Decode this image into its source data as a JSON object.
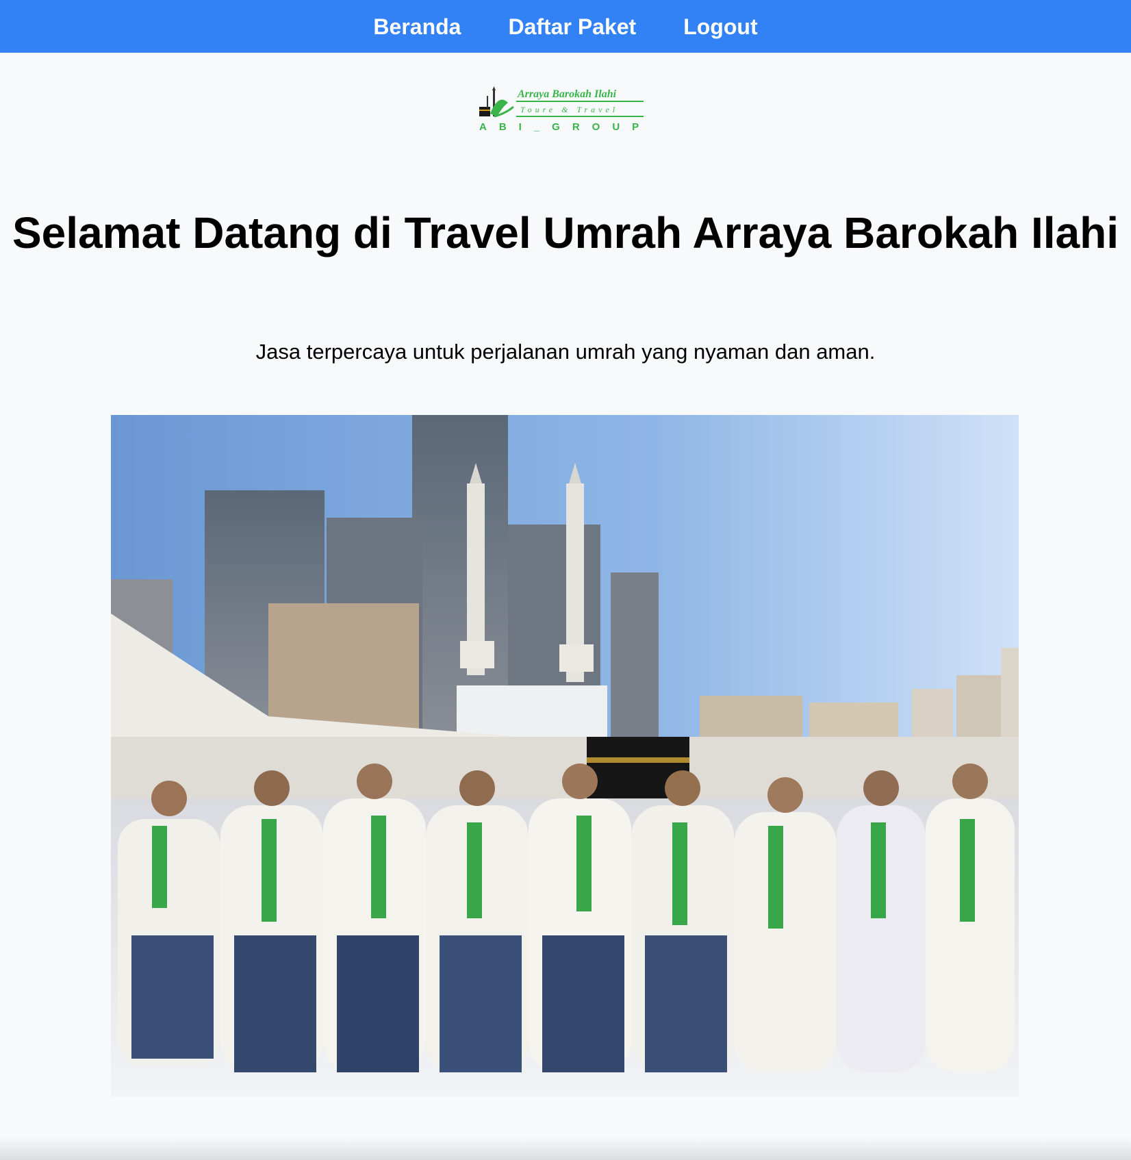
{
  "nav": {
    "items": [
      {
        "label": "Beranda"
      },
      {
        "label": "Daftar Paket"
      },
      {
        "label": "Logout"
      }
    ],
    "background_color": "#3382f5"
  },
  "logo": {
    "line1": "Arraya Barokah Ilahi",
    "line2": "Toure & Travel",
    "line3": "ABI_GROUP",
    "colors": {
      "green": "#38b449",
      "light_green": "#8ee06a"
    }
  },
  "hero": {
    "title": "Selamat Datang di Travel Umrah Arraya Barokah Ilahi",
    "subtitle": "Jasa terpercaya untuk perjalanan umrah yang nyaman dan aman."
  }
}
